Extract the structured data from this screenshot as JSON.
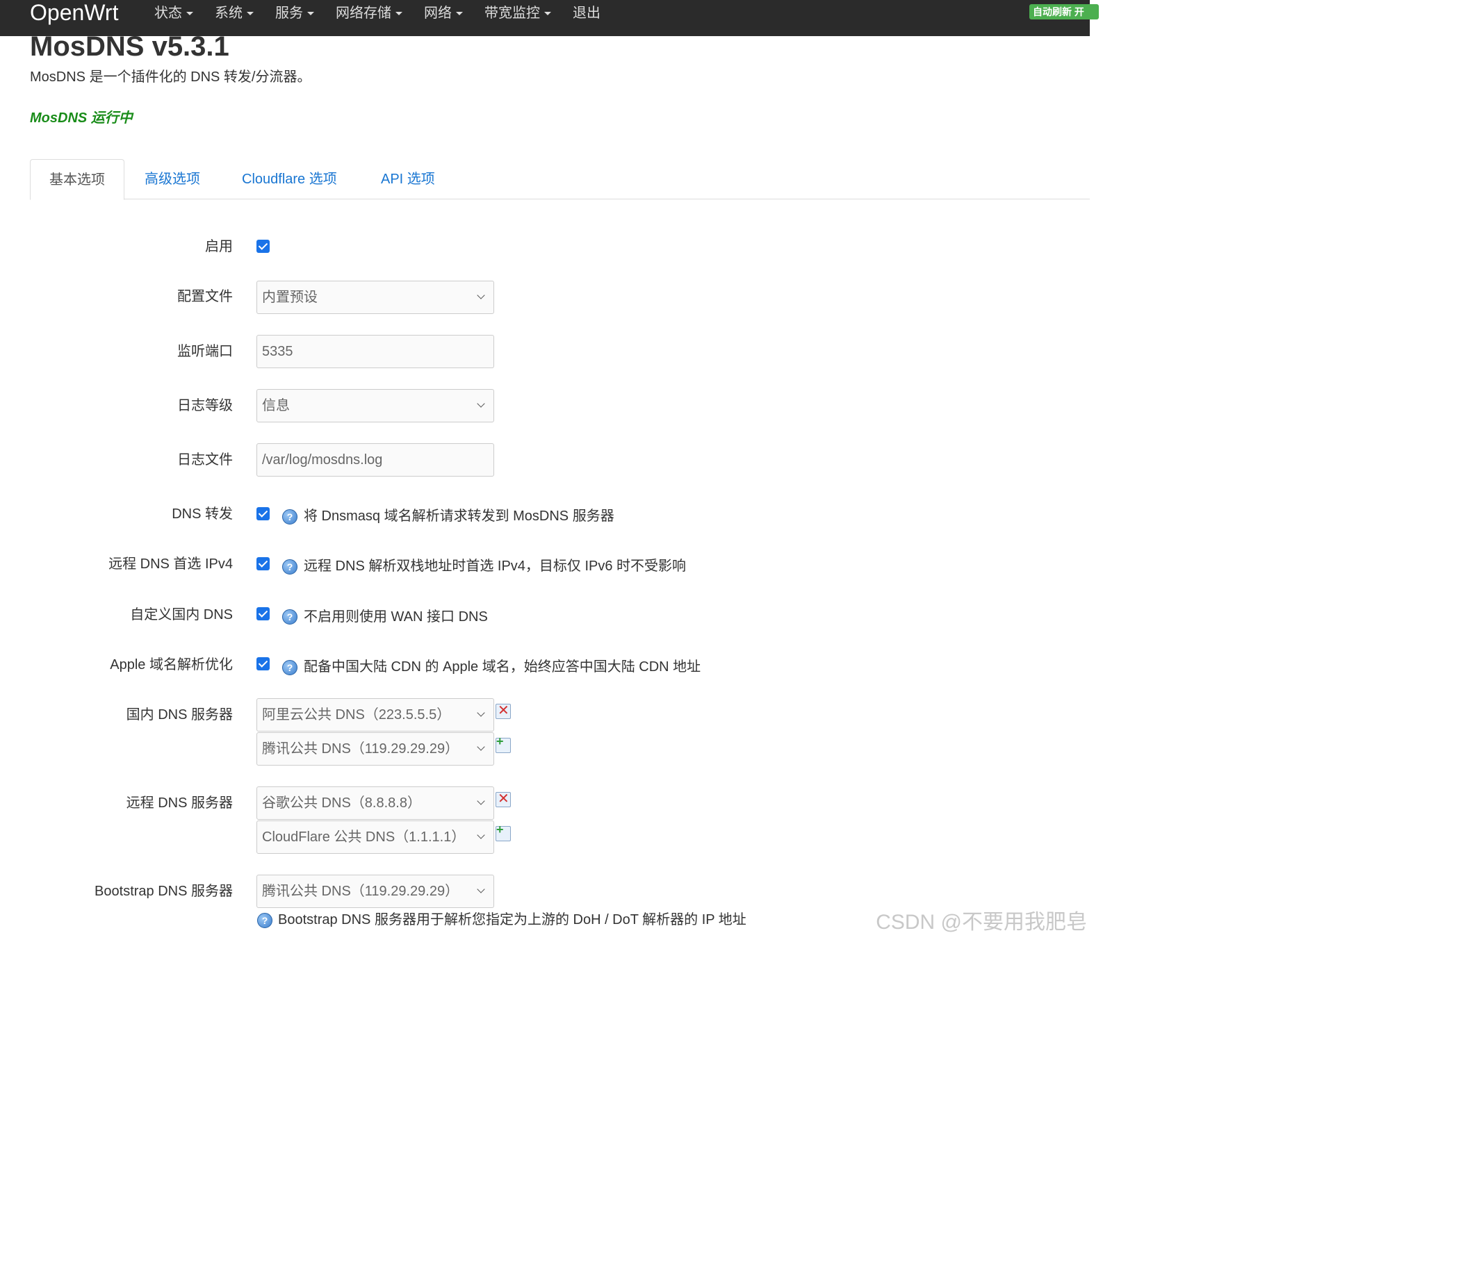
{
  "navbar": {
    "brand": "OpenWrt",
    "menu": [
      "状态",
      "系统",
      "服务",
      "网络存储",
      "网络",
      "带宽监控",
      "退出"
    ],
    "refresh_badge": "自动刷新 开"
  },
  "page": {
    "title": "MosDNS v5.3.1",
    "description": "MosDNS 是一个插件化的 DNS 转发/分流器。",
    "status": "MosDNS 运行中"
  },
  "tabs": [
    "基本选项",
    "高级选项",
    "Cloudflare 选项",
    "API 选项"
  ],
  "form": {
    "enable": {
      "label": "启用",
      "checked": true
    },
    "config_file": {
      "label": "配置文件",
      "value": "内置预设"
    },
    "listen_port": {
      "label": "监听端口",
      "value": "5335"
    },
    "log_level": {
      "label": "日志等级",
      "value": "信息"
    },
    "log_file": {
      "label": "日志文件",
      "value": "/var/log/mosdns.log"
    },
    "dns_forward": {
      "label": "DNS 转发",
      "checked": true,
      "help": "将 Dnsmasq 域名解析请求转发到 MosDNS 服务器"
    },
    "prefer_ipv4": {
      "label": "远程 DNS 首选 IPv4",
      "checked": true,
      "help": "远程 DNS 解析双栈地址时首选 IPv4，目标仅 IPv6 时不受影响"
    },
    "custom_local_dns": {
      "label": "自定义国内 DNS",
      "checked": true,
      "help": "不启用则使用 WAN 接口 DNS"
    },
    "apple_optimize": {
      "label": "Apple 域名解析优化",
      "checked": true,
      "help": "配备中国大陆 CDN 的 Apple 域名，始终应答中国大陆 CDN 地址"
    },
    "local_dns": {
      "label": "国内 DNS 服务器",
      "values": [
        "阿里云公共 DNS（223.5.5.5）",
        "腾讯公共 DNS（119.29.29.29）"
      ]
    },
    "remote_dns": {
      "label": "远程 DNS 服务器",
      "values": [
        "谷歌公共 DNS（8.8.8.8）",
        "CloudFlare 公共 DNS（1.1.1.1）"
      ]
    },
    "bootstrap_dns": {
      "label": "Bootstrap DNS 服务器",
      "value": "腾讯公共 DNS（119.29.29.29）",
      "help": "Bootstrap DNS 服务器用于解析您指定为上游的 DoH / DoT 解析器的 IP 地址"
    }
  },
  "watermark": "CSDN @不要用我肥皂",
  "colors": {
    "navbar": "#2b2b2b",
    "link": "#1976d2",
    "status_green": "#198c19",
    "checkbox": "#1a73e8",
    "badge": "#4caf50"
  }
}
